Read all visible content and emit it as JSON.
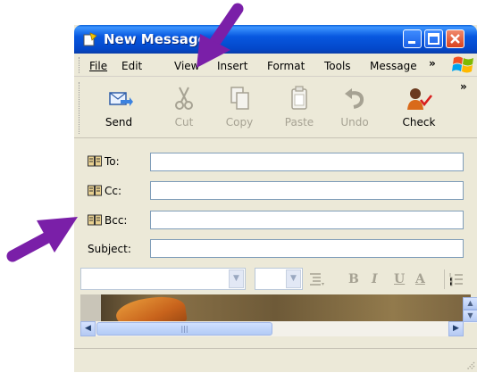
{
  "window": {
    "title": "New Message"
  },
  "menu": {
    "items": [
      {
        "label": "File"
      },
      {
        "label": "Edit"
      },
      {
        "label": "View"
      },
      {
        "label": "Insert"
      },
      {
        "label": "Format"
      },
      {
        "label": "Tools"
      },
      {
        "label": "Message"
      }
    ],
    "overflow": "»"
  },
  "toolbar": {
    "buttons": [
      {
        "label": "Send",
        "icon": "send-icon",
        "enabled": true
      },
      {
        "label": "Cut",
        "icon": "scissors-icon",
        "enabled": false
      },
      {
        "label": "Copy",
        "icon": "copy-icon",
        "enabled": false
      },
      {
        "label": "Paste",
        "icon": "paste-icon",
        "enabled": false
      },
      {
        "label": "Undo",
        "icon": "undo-icon",
        "enabled": false
      },
      {
        "label": "Check",
        "icon": "check-names-icon",
        "enabled": true
      }
    ],
    "overflow": "»"
  },
  "fields": [
    {
      "label": "To:",
      "value": "",
      "has_book": true
    },
    {
      "label": "Cc:",
      "value": "",
      "has_book": true
    },
    {
      "label": "Bcc:",
      "value": "",
      "has_book": true
    },
    {
      "label": "Subject:",
      "value": "",
      "has_book": false
    }
  ],
  "format": {
    "bold": "B",
    "italic": "I",
    "underline": "U",
    "color": "A"
  },
  "colors": {
    "title_blue": "#0858e0",
    "annotation_arrow": "#7a1fa8",
    "chrome": "#ece9d8"
  }
}
